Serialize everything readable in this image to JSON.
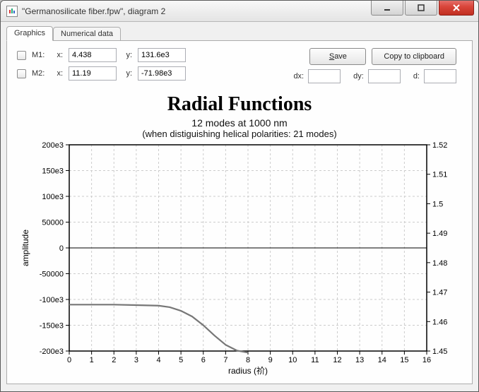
{
  "window": {
    "title": "\"Germanosilicate fiber.fpw\", diagram 2"
  },
  "tabs": [
    {
      "label": "Graphics",
      "active": true
    },
    {
      "label": "Numerical data",
      "active": false
    }
  ],
  "markers": {
    "m1": {
      "label": "M1:",
      "x": "4.438",
      "y": "131.6e3"
    },
    "m2": {
      "label": "M2:",
      "x": "11.19",
      "y": "-71.98e3"
    },
    "x_lbl": "x:",
    "y_lbl": "y:"
  },
  "delta": {
    "dx_lbl": "dx:",
    "dy_lbl": "dy:",
    "d_lbl": "d:",
    "dx": "",
    "dy": "",
    "d": ""
  },
  "buttons": {
    "save_pre": "",
    "save_ul": "S",
    "save_post": "ave",
    "copy": "Copy to clipboard"
  },
  "chart": {
    "title": "Radial Functions",
    "subtitle1": "12 modes at 1000 nm",
    "subtitle2": "(when distiguishing helical polarities: 21 modes)",
    "ylabel": "amplitude",
    "xlabel": "radius (祄)"
  },
  "chart_data": {
    "type": "line",
    "xlabel": "radius (祄)",
    "ylabel_left": "amplitude",
    "ylabel_right": "",
    "xlim": [
      0,
      16
    ],
    "ylim_left": [
      -200000,
      200000
    ],
    "ylim_right": [
      1.45,
      1.52
    ],
    "xticks": [
      0,
      1,
      2,
      3,
      4,
      5,
      6,
      7,
      8,
      9,
      10,
      11,
      12,
      13,
      14,
      15,
      16
    ],
    "yticks_left_labels": [
      "200e3",
      "150e3",
      "100e3",
      "50000",
      "0",
      "-50000",
      "-100e3",
      "-150e3",
      "-200e3"
    ],
    "yticks_left_values": [
      200000,
      150000,
      100000,
      50000,
      0,
      -50000,
      -100000,
      -150000,
      -200000
    ],
    "yticks_right_labels": [
      "1.52",
      "1.51",
      "1.5",
      "1.49",
      "1.48",
      "1.47",
      "1.46",
      "1.45"
    ],
    "yticks_right_values": [
      1.52,
      1.51,
      1.5,
      1.49,
      1.48,
      1.47,
      1.46,
      1.45
    ],
    "series": [
      {
        "name": "zero-line",
        "axis": "left",
        "x": [
          0,
          16
        ],
        "y": [
          0,
          0
        ],
        "style": "thin"
      },
      {
        "name": "mode-curve",
        "axis": "left",
        "x": [
          0,
          1,
          2,
          3,
          4,
          4.5,
          5,
          5.5,
          6,
          6.5,
          7,
          7.5,
          8
        ],
        "y": [
          -110000,
          -110000,
          -110000,
          -111000,
          -112000,
          -115000,
          -122000,
          -133000,
          -150000,
          -170000,
          -188000,
          -199000,
          -203000
        ],
        "style": "thick"
      }
    ]
  }
}
